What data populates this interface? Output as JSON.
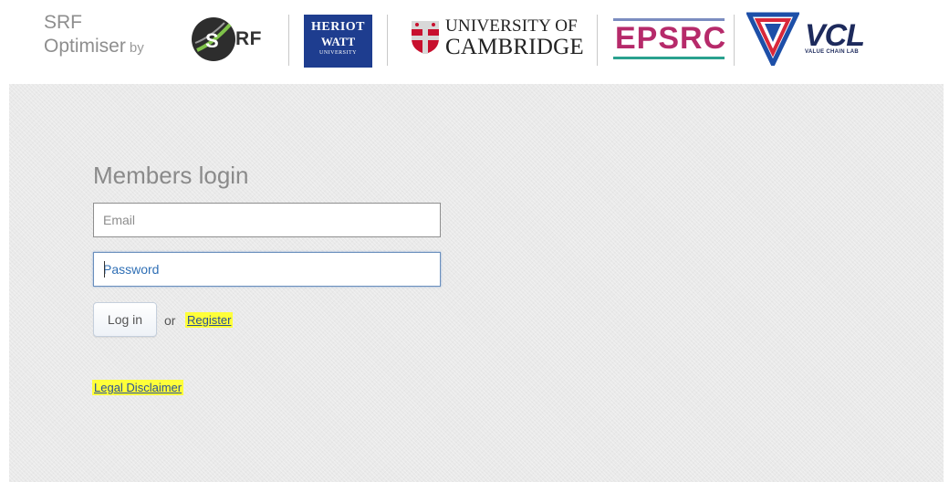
{
  "header": {
    "brand_line1": "SRF",
    "brand_line2": "Optimiser",
    "brand_by": "by",
    "logos": {
      "srf": "RF",
      "heriot_watt_line1": "HERIOT",
      "heriot_watt_line2": "WATT",
      "heriot_watt_line3": "UNIVERSITY",
      "cambridge_line1": "UNIVERSITY OF",
      "cambridge_line2": "CAMBRIDGE",
      "epsrc": "EPSRC",
      "vcl": "VCL",
      "vcl_sub": "VALUE CHAIN LAB"
    }
  },
  "login": {
    "title": "Members login",
    "email_placeholder": "Email",
    "password_placeholder": "Password",
    "login_button": "Log in",
    "or_text": "or",
    "register_link": "Register",
    "legal_link": "Legal Disclaimer"
  },
  "colors": {
    "highlight": "#ffff3a",
    "link": "#2a4f96",
    "heriot_watt_blue": "#1e3d8f",
    "epsrc_magenta": "#b62a6a",
    "vcl_navy": "#1d2a5c"
  }
}
